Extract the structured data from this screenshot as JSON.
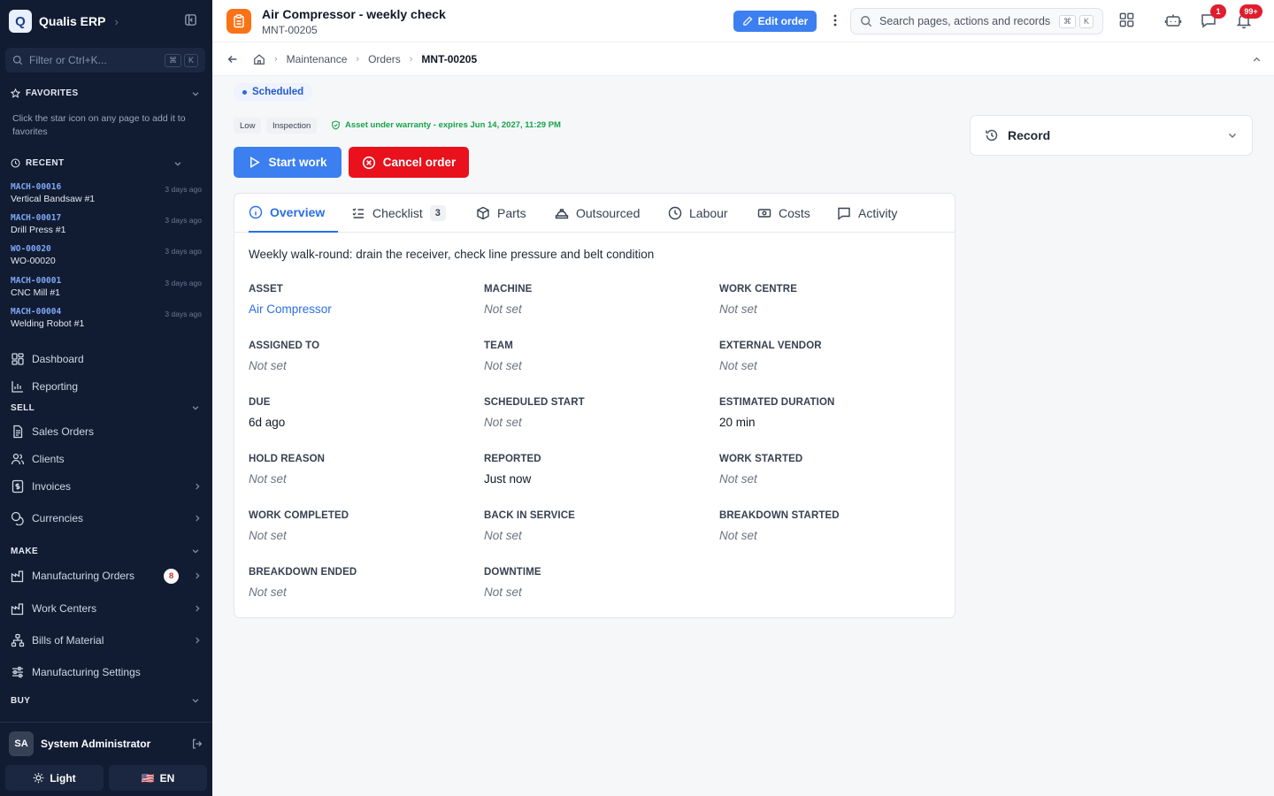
{
  "app": {
    "logo_letter": "Q",
    "name": "Qualis ERP"
  },
  "sidebar": {
    "filter_placeholder": "Filter or Ctrl+K...",
    "filter_keys": [
      "⌘",
      "K"
    ],
    "favorites": {
      "title": "FAVORITES",
      "hint": "Click the star icon on any page to add it to favorites"
    },
    "recent": {
      "title": "RECENT",
      "items": [
        {
          "code": "MACH-00016",
          "name": "Vertical Bandsaw #1",
          "ago": "3 days ago"
        },
        {
          "code": "MACH-00017",
          "name": "Drill Press #1",
          "ago": "3 days ago"
        },
        {
          "code": "WO-00020",
          "name": "WO-00020",
          "ago": "3 days ago"
        },
        {
          "code": "MACH-00001",
          "name": "CNC Mill #1",
          "ago": "3 days ago"
        },
        {
          "code": "MACH-00004",
          "name": "Welding Robot #1",
          "ago": "3 days ago"
        }
      ]
    },
    "nav_top": [
      {
        "label": "Dashboard"
      },
      {
        "label": "Reporting"
      }
    ],
    "sell": {
      "title": "SELL",
      "items": [
        {
          "label": "Sales Orders"
        },
        {
          "label": "Clients"
        },
        {
          "label": "Invoices"
        },
        {
          "label": "Currencies"
        }
      ]
    },
    "make": {
      "title": "MAKE",
      "items": [
        {
          "label": "Manufacturing Orders",
          "badge": "8"
        },
        {
          "label": "Work Centers"
        },
        {
          "label": "Bills of Material"
        },
        {
          "label": "Manufacturing Settings"
        }
      ]
    },
    "buy": {
      "title": "BUY"
    },
    "user": {
      "initials": "SA",
      "name": "System Administrator"
    },
    "theme_label": "Light",
    "lang_flag": "🇺🇸",
    "lang_label": "EN"
  },
  "header": {
    "title": "Air Compressor - weekly check",
    "subtitle": "MNT-00205",
    "edit_label": "Edit order",
    "search_placeholder": "Search pages, actions and records",
    "search_keys": [
      "⌘",
      "K"
    ],
    "messages_badge": "1",
    "notifications_badge": "99+"
  },
  "breadcrumb": {
    "items": [
      "Maintenance",
      "Orders"
    ],
    "current": "MNT-00205"
  },
  "order": {
    "status": "Scheduled",
    "priority": "Low",
    "type": "Inspection",
    "warranty": "Asset under warranty - expires Jun 14, 2027, 11:29 PM",
    "start_label": "Start work",
    "cancel_label": "Cancel order",
    "description": "Weekly walk-round: drain the receiver, check line pressure and belt condition"
  },
  "tabs": [
    {
      "label": "Overview"
    },
    {
      "label": "Checklist",
      "count": "3"
    },
    {
      "label": "Parts"
    },
    {
      "label": "Outsourced"
    },
    {
      "label": "Labour"
    },
    {
      "label": "Costs"
    },
    {
      "label": "Activity"
    }
  ],
  "fields": [
    {
      "label": "ASSET",
      "value": "Air Compressor"
    },
    {
      "label": "MACHINE",
      "value": "Not set"
    },
    {
      "label": "WORK CENTRE",
      "value": "Not set"
    },
    {
      "label": "ASSIGNED TO",
      "value": "Not set"
    },
    {
      "label": "TEAM",
      "value": "Not set"
    },
    {
      "label": "EXTERNAL VENDOR",
      "value": "Not set"
    },
    {
      "label": "DUE",
      "value": "6d ago"
    },
    {
      "label": "SCHEDULED START",
      "value": "Not set"
    },
    {
      "label": "ESTIMATED DURATION",
      "value": "20 min"
    },
    {
      "label": "HOLD REASON",
      "value": "Not set"
    },
    {
      "label": "REPORTED",
      "value": "Just now"
    },
    {
      "label": "WORK STARTED",
      "value": "Not set"
    },
    {
      "label": "WORK COMPLETED",
      "value": "Not set"
    },
    {
      "label": "BACK IN SERVICE",
      "value": "Not set"
    },
    {
      "label": "BREAKDOWN STARTED",
      "value": "Not set"
    },
    {
      "label": "BREAKDOWN ENDED",
      "value": "Not set"
    },
    {
      "label": "DOWNTIME",
      "value": "Not set"
    }
  ],
  "record_panel": {
    "label": "Record"
  },
  "colors": {
    "sidebar_bg": "#111c33",
    "accent": "#3b7ff0",
    "danger": "#e8111c",
    "orange": "#f97316",
    "success": "#16a34a"
  }
}
